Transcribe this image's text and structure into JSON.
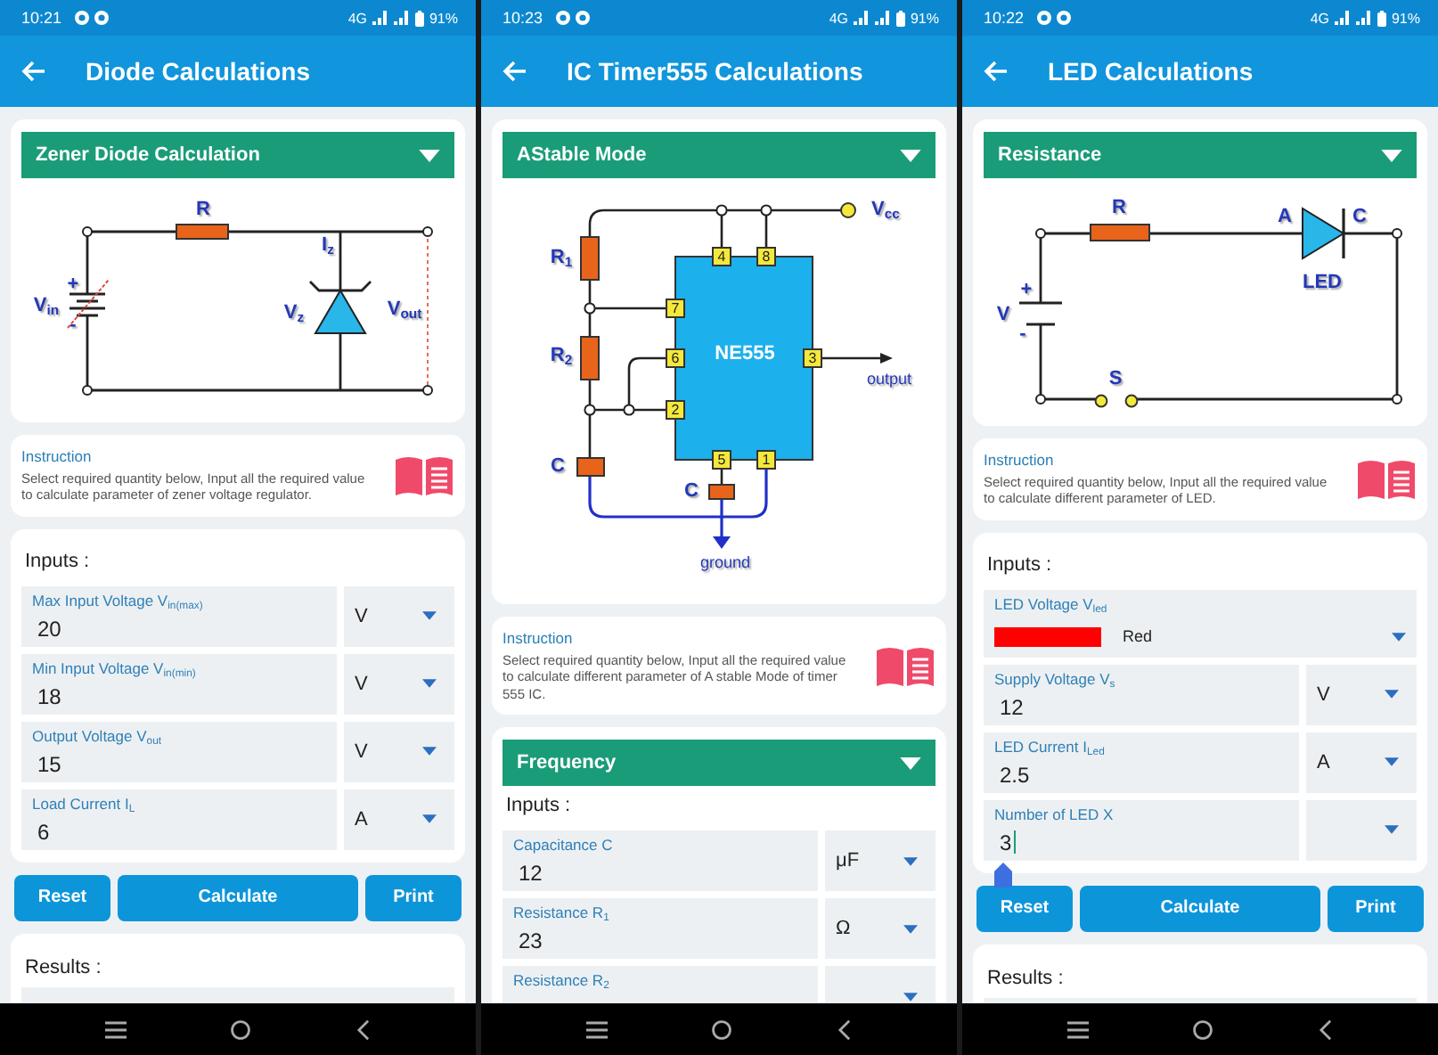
{
  "phones": [
    {
      "status_bar": {
        "time": "10:21",
        "network": "4G",
        "battery": "91%"
      },
      "title": "Diode Calculations",
      "diagram_card": {
        "dropdown": "Zener Diode Calculation",
        "diagram": {
          "kind": "zener",
          "labels": [
            {
              "kind": "label",
              "text": "R"
            },
            {
              "kind": "label",
              "text": "I$_{z}$"
            },
            {
              "kind": "label",
              "text": "V$_{in}$"
            },
            {
              "kind": "label",
              "text": "V$_{z}$"
            },
            {
              "kind": "label",
              "text": "V$_{out}$"
            },
            {
              "kind": "label",
              "text": "+"
            },
            {
              "kind": "label",
              "text": "-"
            }
          ]
        }
      },
      "instruction": {
        "heading": "Instruction",
        "text": "Select required quantity below, Input all the required value to calculate parameter of zener voltage regulator."
      },
      "inputs": {
        "heading": "Inputs :",
        "fields": [
          {
            "kind": "input",
            "label": "Max Input Voltage V$_{in(max)}$",
            "value": "20",
            "unit": "V",
            "focused": false
          },
          {
            "kind": "input",
            "label": "Min Input Voltage V$_{in(min)}$",
            "value": "18",
            "unit": "V",
            "focused": false
          },
          {
            "kind": "input",
            "label": "Output Voltage V$_{out}$",
            "value": "15",
            "unit": "V",
            "focused": false
          },
          {
            "kind": "input",
            "label": "Load Current I$_{L}$",
            "value": "6",
            "unit": "A",
            "focused": false
          }
        ]
      },
      "buttons": [
        "Reset",
        "Calculate",
        "Print"
      ],
      "results": {
        "heading": "Results :"
      }
    },
    {
      "status_bar": {
        "time": "10:23",
        "network": "4G",
        "battery": "91%"
      },
      "title": "IC Timer555 Calculations",
      "diagram_card": {
        "dropdown": "AStable Mode",
        "diagram": {
          "kind": "timer555",
          "labels": [
            {
              "kind": "label",
              "text": "V$_{cc}$"
            },
            {
              "kind": "label",
              "text": "R$_{1}$"
            },
            {
              "kind": "pin",
              "text": "4"
            },
            {
              "kind": "pin",
              "text": "8"
            },
            {
              "kind": "pin",
              "text": "7"
            },
            {
              "kind": "label",
              "text": "R$_{2}$"
            },
            {
              "kind": "pin",
              "text": "6"
            },
            {
              "kind": "chip",
              "text": "NE555"
            },
            {
              "kind": "pin",
              "text": "3"
            },
            {
              "kind": "small",
              "text": "output"
            },
            {
              "kind": "pin",
              "text": "2"
            },
            {
              "kind": "label",
              "text": "C"
            },
            {
              "kind": "pin",
              "text": "5"
            },
            {
              "kind": "pin",
              "text": "1"
            },
            {
              "kind": "label",
              "text": "C"
            },
            {
              "kind": "small",
              "text": "ground"
            }
          ]
        }
      },
      "instruction": {
        "heading": "Instruction",
        "text": "Select required quantity below, Input all the required value to calculate different parameter of A stable Mode of timer 555 IC."
      },
      "inputs": {
        "dropdown": "Frequency",
        "heading": "Inputs :",
        "fields": [
          {
            "kind": "input",
            "label": "Capacitance C",
            "value": "12",
            "unit": "μF",
            "focused": false
          },
          {
            "kind": "input",
            "label": "Resistance R$_{1}$",
            "value": "23",
            "unit": "Ω",
            "focused": false
          },
          {
            "kind": "input",
            "label": "Resistance R$_{2}$",
            "focused": false
          }
        ]
      }
    },
    {
      "status_bar": {
        "time": "10:22",
        "network": "4G",
        "battery": "91%"
      },
      "title": "LED Calculations",
      "diagram_card": {
        "dropdown": "Resistance",
        "diagram": {
          "kind": "led",
          "labels": [
            {
              "kind": "label",
              "text": "R"
            },
            {
              "kind": "label",
              "text": "A"
            },
            {
              "kind": "label",
              "text": "C"
            },
            {
              "kind": "label",
              "text": "LED"
            },
            {
              "kind": "label",
              "text": "+"
            },
            {
              "kind": "label",
              "text": "V"
            },
            {
              "kind": "label",
              "text": "-"
            },
            {
              "kind": "label",
              "text": "S"
            }
          ]
        }
      },
      "instruction": {
        "heading": "Instruction",
        "text": "Select required quantity below, Input all the required value to calculate different parameter of LED."
      },
      "inputs": {
        "heading": "Inputs :",
        "fields": [
          {
            "kind": "color",
            "label": "LED Voltage V$_{led}$",
            "color": "#ff0000",
            "value": "Red"
          },
          {
            "kind": "input",
            "label": "Supply Voltage V$_{s}$",
            "value": "12",
            "unit": "V",
            "focused": false
          },
          {
            "kind": "input",
            "label": "LED Current I$_{Led}$",
            "value": "2.5",
            "unit": "A",
            "focused": false
          },
          {
            "kind": "input",
            "label": "Number of LED X",
            "value": "3",
            "focused": true
          }
        ]
      },
      "buttons": [
        "Reset",
        "Calculate",
        "Print"
      ],
      "results": {
        "heading": "Results :"
      }
    }
  ]
}
